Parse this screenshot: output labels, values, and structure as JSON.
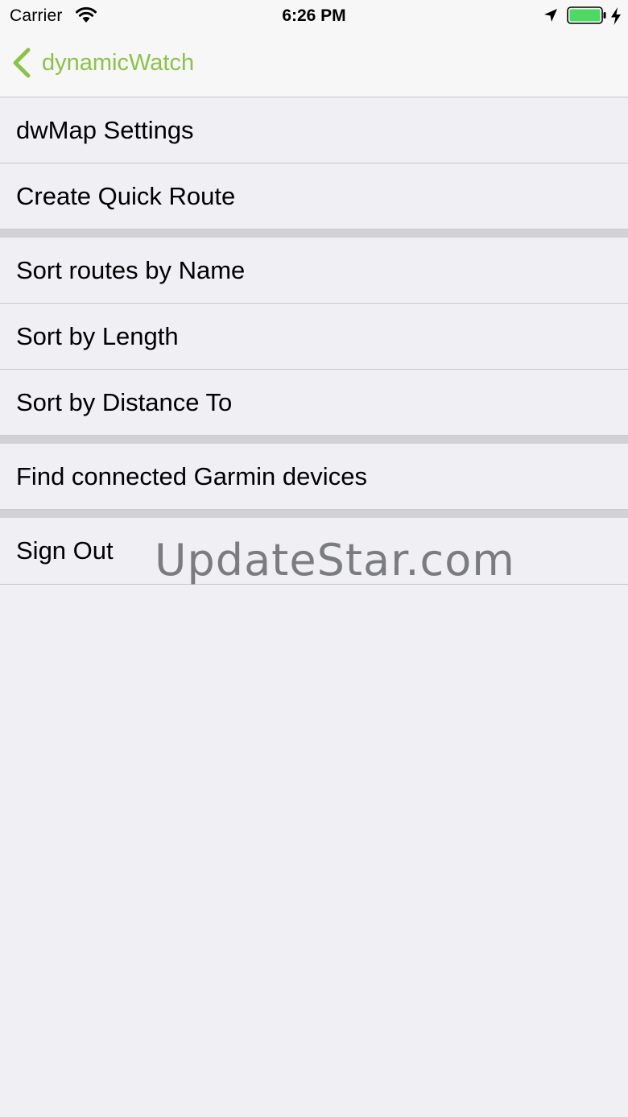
{
  "status_bar": {
    "carrier": "Carrier",
    "time": "6:26 PM",
    "icons": [
      "wifi-icon",
      "location-arrow-icon",
      "battery-icon",
      "charging-bolt-icon"
    ],
    "battery_color": "#4cd964"
  },
  "nav": {
    "back_label": "dynamicWatch",
    "accent_color": "#8bc34a"
  },
  "menu": {
    "sections": [
      [
        "dwMap Settings",
        "Create Quick Route"
      ],
      [
        "Sort routes by Name",
        "Sort by Length",
        "Sort by Distance To"
      ],
      [
        "Find connected Garmin devices"
      ],
      [
        "Sign Out"
      ]
    ]
  },
  "watermark": "UpdateStar.com"
}
